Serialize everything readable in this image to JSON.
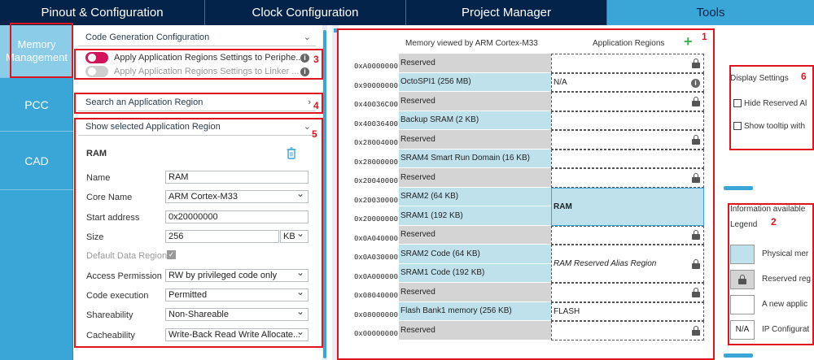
{
  "tabs": [
    "Pinout & Configuration",
    "Clock Configuration",
    "Project Manager",
    "Tools"
  ],
  "nav": [
    "Memory Management",
    "PCC",
    "CAD"
  ],
  "sections": {
    "codegen": "Code Generation Configuration",
    "apply_periph": "Apply Application Regions Settings to Periphe...",
    "apply_linker": "Apply Application Regions Settings to Linker ...",
    "search": "Search an Application Region",
    "show": "Show selected Application Region"
  },
  "region_form": {
    "title": "RAM",
    "name_label": "Name",
    "name_value": "RAM",
    "core_label": "Core Name",
    "core_value": "ARM Cortex-M33",
    "start_label": "Start address",
    "start_value": "0x20000000",
    "size_label": "Size",
    "size_value": "256",
    "size_unit": "KB",
    "default_label": "Default Data Region",
    "access_label": "Access Permission",
    "access_value": "RW by privileged code only",
    "exec_label": "Code execution",
    "exec_value": "Permitted",
    "share_label": "Shareability",
    "share_value": "Non-Shareable",
    "cache_label": "Cacheability",
    "cache_value": "Write-Back Read Write Allocate..."
  },
  "memory": {
    "header_left": "Memory viewed by ARM Cortex-M33",
    "header_right": "Application Regions",
    "addresses": [
      "0xA0000000",
      "0x90000000",
      "0x40036C00",
      "0x40036400",
      "0x28004000",
      "0x28000000",
      "0x20040000",
      "0x20030000",
      "0x20000000",
      "0x0A040000",
      "0x0A030000",
      "0x0A000000",
      "0x08040000",
      "0x08000000",
      "0x00000000"
    ],
    "rows": [
      "Reserved",
      "OctoSPI1 (256 MB)",
      "Reserved",
      "Backup SRAM (2 KB)",
      "Reserved",
      "SRAM4 Smart Run Domain (16 KB)",
      "Reserved",
      "SRAM2 (64 KB)",
      "SRAM1 (192 KB)",
      "Reserved",
      "SRAM2 Code (64 KB)",
      "SRAM1 Code (192 KB)",
      "Reserved",
      "Flash Bank1 memory (256 KB)",
      "Reserved"
    ],
    "regions": [
      "",
      "N/A",
      "",
      "",
      "",
      "",
      "",
      "RAM",
      "",
      "RAM Reserved Alias Region",
      "",
      "FLASH",
      ""
    ]
  },
  "display_settings": {
    "title": "Display Settings",
    "hide_reserved": "Hide Reserved Al",
    "show_tooltip": "Show tooltip with"
  },
  "info": {
    "available": "Information available",
    "legend": "Legend",
    "items": [
      "Physical mer",
      "Reserved reg",
      "A new applic",
      "IP Configurat"
    ],
    "na": "N/A"
  },
  "callouts": [
    "1",
    "2",
    "3",
    "4",
    "5",
    "6"
  ],
  "colors": {
    "navy": "#03234b",
    "accent": "#3aa6d8",
    "physical": "#bfe1ec",
    "reserved": "#d4d4d4",
    "toggle_on": "#d4145a",
    "add": "#3cb44b",
    "callout": "#e0141e"
  }
}
